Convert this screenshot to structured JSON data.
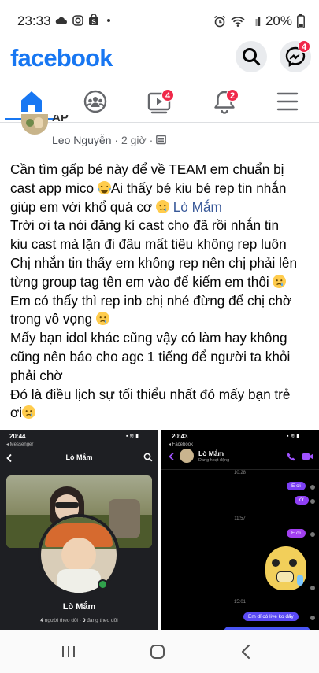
{
  "status_bar": {
    "time": "23:33",
    "battery": "20%"
  },
  "header": {
    "logo": "facebook",
    "search_icon": "search-icon",
    "messenger_icon": "messenger-icon",
    "messenger_badge": "4"
  },
  "tabs": [
    {
      "name": "home",
      "icon": "home-icon",
      "badge": ""
    },
    {
      "name": "groups",
      "icon": "groups-icon",
      "badge": ""
    },
    {
      "name": "watch",
      "icon": "watch-icon",
      "badge": "4"
    },
    {
      "name": "notifications",
      "icon": "bell-icon",
      "badge": "2"
    },
    {
      "name": "menu",
      "icon": "menu-icon",
      "badge": ""
    }
  ],
  "post": {
    "author_partial": "AP",
    "author": "Leo Nguyễn",
    "time": "2 giờ",
    "text_lines": [
      "Cần tìm gấp bé này để về TEAM em chuẩn bị",
      "cast app mico ",
      "Ai thấy bé kiu bé rep tin nhắn",
      "giúp em với khổ quá cơ ",
      "Lò Mắm",
      "Trời ơi ta nói đăng kí cast cho đã rồi nhắn tin",
      "kiu cast mà lặn đi đâu mất tiêu không rep luôn",
      "Chị nhắn tin thấy em không rep nên chị phải lên",
      "từng group tag tên em vào để kiếm em thôi ",
      "Em có thấy thì rep inb chị nhé đừng để chị chờ",
      "trong vô vọng ",
      "Mấy bạn idol khác cũng vậy có làm hay không",
      "cũng nên báo cho agc 1 tiếng để người ta khỏi",
      "phải chờ",
      "Đó là điều lịch sự tối thiểu nhất đó mấy bạn trẻ",
      "ơi"
    ]
  },
  "photo1": {
    "time": "20:44",
    "back_app": "◂ Messenger",
    "name": "Lò Mắm",
    "profile_name": "Lò Mắm",
    "followers": "4",
    "followers_label": "người theo dõi",
    "following": "0",
    "following_label": "đang theo dõi"
  },
  "photo2": {
    "time": "20:43",
    "back_app": "◂ Facebook",
    "name": "Lò Mắm",
    "status": "Đang hoạt động",
    "times": [
      "10:28",
      "11:57",
      "15:01"
    ],
    "messages": [
      "E ơi",
      "Ơ",
      "E ơi",
      "Em dỉ có live ko đấy"
    ]
  }
}
